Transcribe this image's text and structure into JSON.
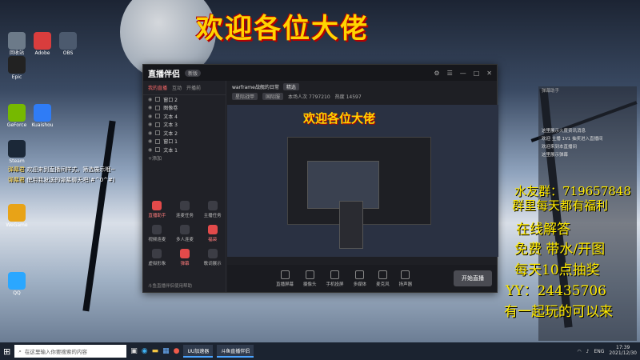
{
  "overlay_title": "欢迎各位大佬",
  "desktop_icons": [
    {
      "label": "回收站",
      "color": "#6c7a89"
    },
    {
      "label": "Adobe",
      "color": "#d93d3d"
    },
    {
      "label": "OBS",
      "color": "#4c5a6e"
    },
    {
      "label": "Epic",
      "color": "#222222"
    },
    {
      "label": "GeForce",
      "color": "#76b900"
    },
    {
      "label": "Kuaishou",
      "color": "#2f7cf6"
    },
    {
      "label": "Steam",
      "color": "#1b2838"
    },
    {
      "label": "WeGame",
      "color": "#e8a317"
    },
    {
      "label": "QQ",
      "color": "#2aa7ff"
    }
  ],
  "window": {
    "logo": "直播伴侣",
    "version": "新版",
    "left_tabs": [
      "我的直播",
      "互动",
      "开播前"
    ],
    "layers": [
      "窗口 2",
      "图像卷",
      "文本 4",
      "文本 3",
      "文本 2",
      "窗口 1",
      "文本 1"
    ],
    "add_scene": "+添加",
    "tools": [
      {
        "label": "直播助手",
        "red": true
      },
      {
        "label": "连麦任务",
        "red": false
      },
      {
        "label": "主播任务",
        "red": false
      },
      {
        "label": "视频连麦",
        "red": false
      },
      {
        "label": "多人连麦",
        "red": false
      },
      {
        "label": "福袋",
        "red": true
      },
      {
        "label": "虚拟形象",
        "red": false
      },
      {
        "label": "弹幕",
        "red": true
      },
      {
        "label": "歌词展示",
        "red": false
      }
    ],
    "footer_text": "斗鱼直播伴侣使用帮助",
    "stream_title": "warframe战舰的日常",
    "stream_badge": "精选",
    "info_row": [
      "星际战甲",
      "国际服"
    ],
    "stats": [
      "本场人次 7797210",
      "热度 14597"
    ],
    "bottom_items": [
      "直播屏幕",
      "摄像头",
      "手机投屏",
      "多媒体",
      "麦克风",
      "扬声器"
    ],
    "start_button": "开始直播"
  },
  "chat_panel": {
    "header": "弹幕助手",
    "lines": [
      "这里展示火度资讯消息",
      "欢迎 主播 1V1 抽奖进入直播间",
      "欢迎来到本直播间",
      "这里展示弹幕"
    ]
  },
  "chat_toasts": [
    {
      "name": "弹幕君",
      "text": "欢迎来到直播间样式，筛选展示哦~"
    },
    {
      "name": "弹幕君",
      "text": "使用我发送的弹幕聊天吧(#^0^#)"
    }
  ],
  "promo_lines": [
    "水友群：719657848",
    "群里每天都有福利",
    "在线解答",
    "免费 带水/开图",
    "每天10点抽奖",
    "YY：24435706",
    "有一起玩的可以来"
  ],
  "taskbar": {
    "search_placeholder": "在这里输入你要搜索的内容",
    "apps": [
      "UU加速器",
      "斗鱼直播伴侣"
    ],
    "lang": "ENG",
    "time": "17:39",
    "date": "2021/12/30"
  }
}
